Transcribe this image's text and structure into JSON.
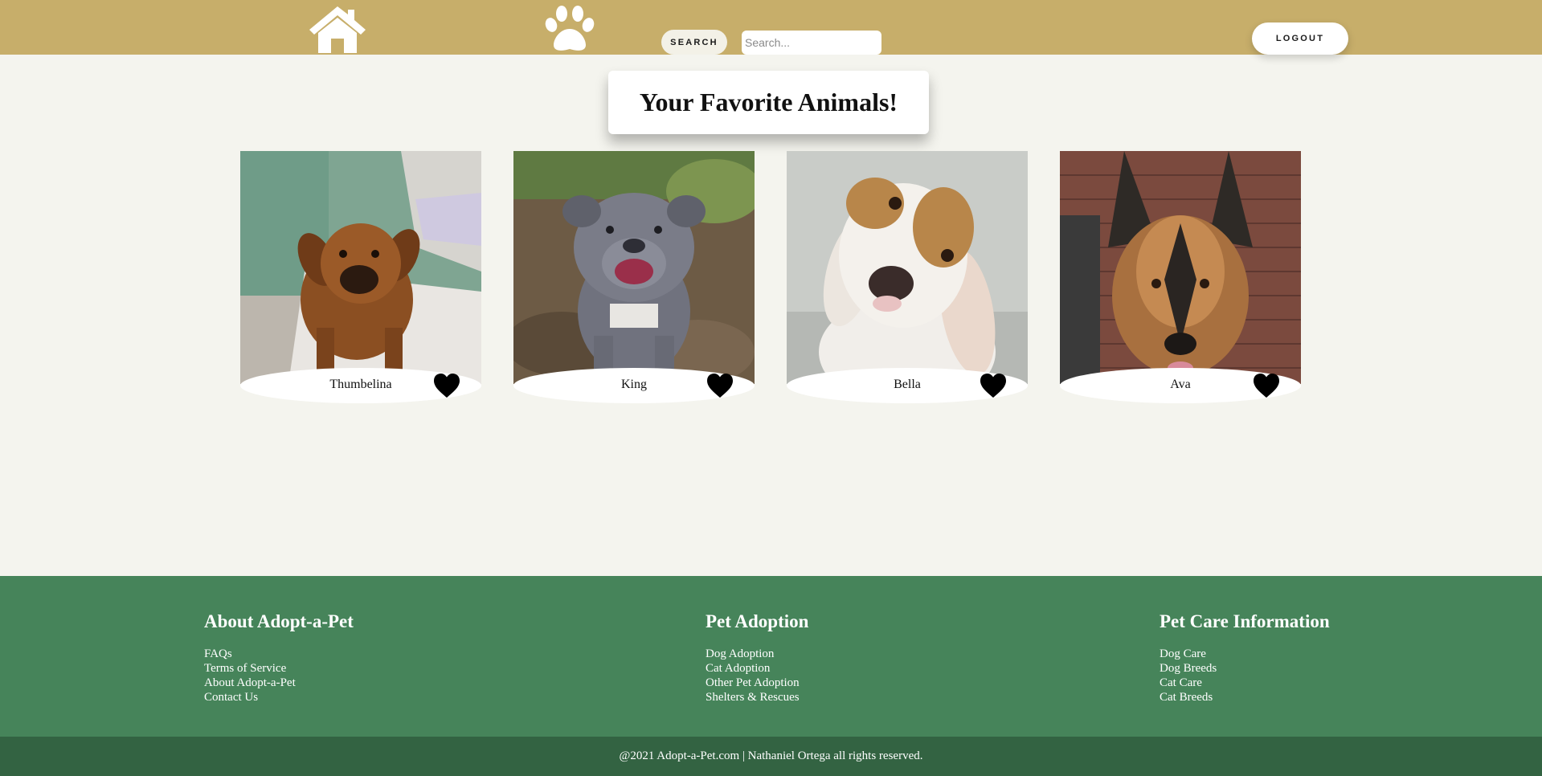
{
  "header": {
    "nav": [
      {
        "icon": "home-icon"
      },
      {
        "icon": "paw-icon"
      }
    ],
    "search_button_label": "SEARCH",
    "search_placeholder": "Search...",
    "search_value": "",
    "logout_label": "LOGOUT",
    "colors": {
      "bar": "#c7ae6a",
      "button": "#f3f1e7"
    }
  },
  "main": {
    "title": "Your Favorite Animals!",
    "pets": [
      {
        "name": "Thumbelina",
        "icon": "heart-icon"
      },
      {
        "name": "King",
        "icon": "heart-icon"
      },
      {
        "name": "Bella",
        "icon": "heart-icon"
      },
      {
        "name": "Ava",
        "icon": "heart-icon"
      }
    ]
  },
  "footer": {
    "columns": [
      {
        "heading": "About Adopt-a-Pet",
        "links": [
          "FAQs",
          "Terms of Service",
          "About Adopt-a-Pet",
          "Contact Us"
        ]
      },
      {
        "heading": "Pet Adoption",
        "links": [
          "Dog Adoption",
          "Cat Adoption",
          "Other Pet Adoption",
          "Shelters & Rescues"
        ]
      },
      {
        "heading": "Pet Care Information",
        "links": [
          "Dog Care",
          "Dog Breeds",
          "Cat Care",
          "Cat Breeds"
        ]
      }
    ],
    "copyright": "@2021 Adopt-a-Pet.com | Nathaniel Ortega all rights reserved.",
    "colors": {
      "main": "#46845a",
      "bottom": "#336342"
    }
  }
}
